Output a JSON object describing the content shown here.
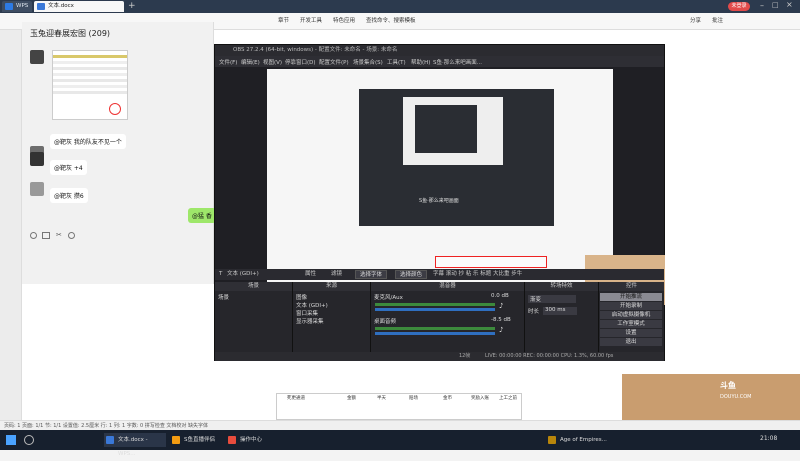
{
  "wps": {
    "app_tab": "WPS",
    "doc_tab": "文本.docx",
    "ribbon_items": [
      "章节",
      "开发工具",
      "特色应用",
      "查找命令、搜索模板",
      "分享",
      "批注"
    ],
    "share_btn": "分享",
    "user_badge": "未登录",
    "status_text": "页码: 1  页面: 1/1  节: 1/1  设置值: 2.5厘米  行: 1  列: 1  字数: 0  拼写检查  文档校对  缺失字体"
  },
  "chat": {
    "title": "玉兔迎春展宏图 (209)",
    "messages": [
      {
        "text": "@靶灰 我的队友不见一个"
      },
      {
        "text": "@靶灰 +4"
      },
      {
        "text": "@靶灰 攒6"
      }
    ],
    "green_bubble": "@猛 香"
  },
  "obs": {
    "title": "OBS 27.2.4 (64-bit, windows) - 配置文件: 未命名 - 场景: 未命名",
    "menu": [
      "文件(F)",
      "编辑(E)",
      "视图(V)",
      "停靠窗口(D)",
      "配置文件(P)",
      "场景集合(S)",
      "工具(T)",
      "帮助(H)",
      "S鱼·那么来吧画面..."
    ],
    "inner_capture_label": "S鱼·那么来吧画面",
    "source_bar": {
      "label": "文本 (GDI+)",
      "properties": "属性",
      "filters": "滤镜",
      "select_font": "选择字体",
      "select_color": "选择颜色",
      "text_settings": "字幕 滚动 抄 粘 乐 标题 大比重 步牛"
    },
    "docks": {
      "scenes": {
        "title": "场景",
        "items": [
          "场景"
        ]
      },
      "sources": {
        "title": "来源",
        "items": [
          "图像",
          "文本 (GDI+)",
          "窗口采集",
          "显示器采集"
        ]
      },
      "mixer": {
        "title": "混音器",
        "tracks": [
          {
            "name": "麦克风/Aux",
            "value": "0.0 dB"
          },
          {
            "name": "桌面音频",
            "value": "-8.5 dB"
          }
        ]
      },
      "transitions": {
        "title": "转场特效",
        "type": "渐变",
        "duration_label": "时长",
        "duration_value": "300 ms"
      },
      "controls": {
        "title": "控件",
        "buttons": [
          "开始推流",
          "开始录制",
          "启动虚拟摄像机",
          "工作室模式",
          "设置",
          "退出"
        ]
      }
    },
    "status": "LIVE: 00:00:00   REC: 00:00:00   CPU: 1.3%, 60.00 fps",
    "status_marker": "12帧"
  },
  "sheet_bottom": {
    "headers": [
      "死更通道",
      "金额",
      "半天",
      "赔场",
      "金币",
      "奖励入账",
      "上工之前"
    ]
  },
  "cam": {
    "logo": "斗鱼",
    "site": "DOUYU.COM",
    "room_number": "750143"
  },
  "taskbar": {
    "items": [
      "文本.docx - WPS...",
      "S鱼直播伴侣",
      "操作中心",
      "Age of Empires..."
    ],
    "time": "21:08"
  }
}
